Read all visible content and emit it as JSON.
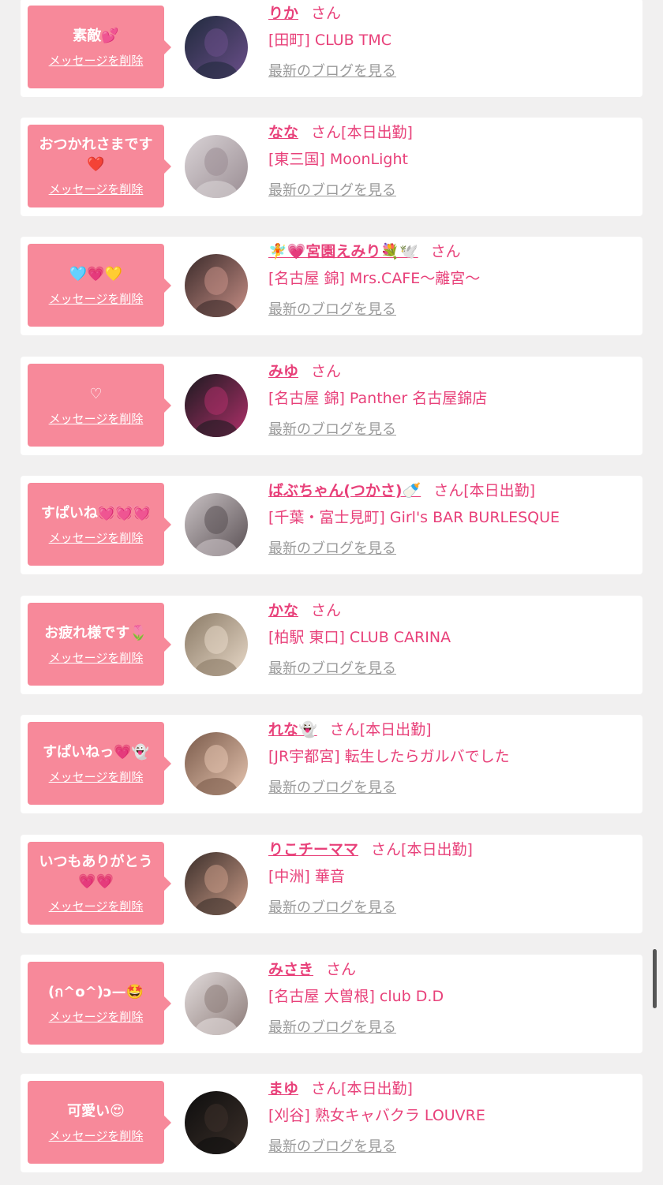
{
  "labels": {
    "delete": "メッセージを削除",
    "blog": "最新のブログを見る",
    "san": "さん"
  },
  "entries": [
    {
      "message": "素敵💕",
      "name": "りか",
      "status": "",
      "shop": "[田町] CLUB TMC",
      "avatar_colors": [
        "#1f2a3c",
        "#6b4f8a"
      ]
    },
    {
      "message": "おつかれさまです❤️",
      "name": "なな",
      "status": "[本日出勤]",
      "shop": "[東三国] MoonLight",
      "avatar_colors": [
        "#d9d3d6",
        "#9a8d93"
      ]
    },
    {
      "message": "🩵💗💛",
      "name": "🧚💗宮園えみり💐🕊️",
      "status": "",
      "shop": "[名古屋 錦] Mrs.CAFE〜離宮〜",
      "avatar_colors": [
        "#3a2a2a",
        "#c78f86"
      ]
    },
    {
      "message": "♡",
      "name": "みゆ",
      "status": "",
      "shop": "[名古屋 錦] Panther 名古屋錦店",
      "avatar_colors": [
        "#1a1a1f",
        "#b0306a"
      ]
    },
    {
      "message": "すぱいね💓💓💓",
      "name": "ばぶちゃん(つかさ)🍼",
      "status": "[本日出勤]",
      "shop": "[千葉・富士見町] Girl's BAR BURLESQUE",
      "avatar_colors": [
        "#c9c2c4",
        "#5a5054"
      ]
    },
    {
      "message": "お疲れ様です🌷",
      "name": "かな",
      "status": "",
      "shop": "[柏駅 東口] CLUB CARINA",
      "avatar_colors": [
        "#8a7a66",
        "#e8d9c8"
      ]
    },
    {
      "message": "すぱいねっ💗👻",
      "name": "れな👻",
      "status": "[本日出勤]",
      "shop": "[JR宇都宮] 転生したらガルバでした",
      "avatar_colors": [
        "#7a5a4a",
        "#e6c5b0"
      ]
    },
    {
      "message": "いつもありがとう💗💗",
      "name": "りこチーママ",
      "status": "[本日出勤]",
      "shop": "[中洲] 華音",
      "avatar_colors": [
        "#3b2e2a",
        "#c99b87"
      ]
    },
    {
      "message": "(ก^o^)ɔ—🤩",
      "name": "みさき",
      "status": "",
      "shop": "[名古屋 大曽根] club D.D",
      "avatar_colors": [
        "#e2dcdc",
        "#8c7b78"
      ]
    },
    {
      "message": "可愛い😍",
      "name": "まゆ",
      "status": "[本日出勤]",
      "shop": "[刈谷] 熟女キャバクラ LOUVRE",
      "avatar_colors": [
        "#0d0d0d",
        "#3c302a"
      ]
    }
  ]
}
